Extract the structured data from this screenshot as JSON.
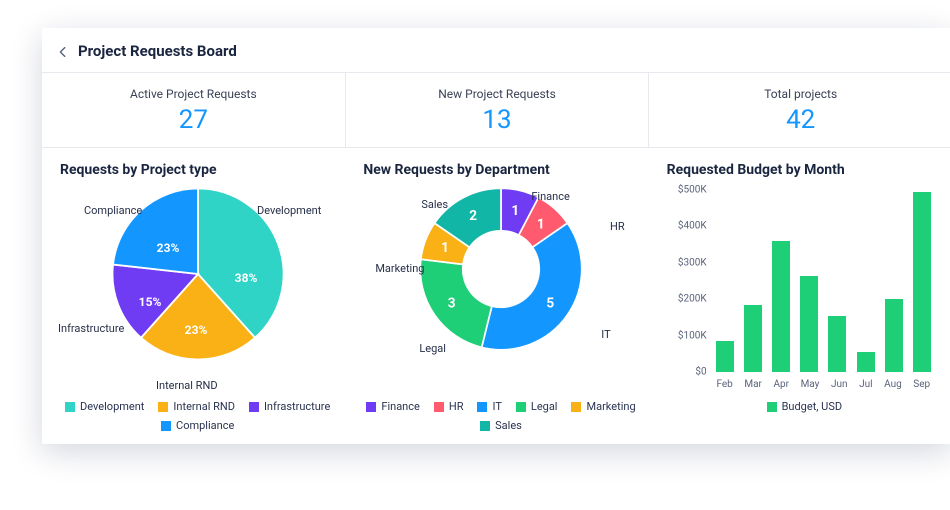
{
  "header": {
    "title": "Project Requests Board"
  },
  "kpis": [
    {
      "label": "Active Project Requests",
      "value": "27"
    },
    {
      "label": "New Project Requests",
      "value": "13"
    },
    {
      "label": "Total projects",
      "value": "42"
    }
  ],
  "panel1": {
    "title": "Requests by Project type"
  },
  "panel2": {
    "title": "New Requests by Department"
  },
  "panel3": {
    "title": "Requested Budget by Month"
  },
  "colors": {
    "development": "#2fd4c6",
    "internal_rnd": "#f9b116",
    "infrastructure": "#6f3cf4",
    "compliance": "#1496ff",
    "finance": "#6f3cf4",
    "hr": "#ff5a6e",
    "it": "#1496ff",
    "legal": "#1ecf78",
    "marketing": "#f9b116",
    "sales": "#12b6a6",
    "budget": "#1ecf78"
  },
  "chart_data": [
    {
      "type": "pie",
      "title": "Requests by Project type",
      "series": [
        {
          "name": "Development",
          "value": 38,
          "label": "38%",
          "color": "#2fd4c6"
        },
        {
          "name": "Internal RND",
          "value": 23,
          "label": "23%",
          "color": "#f9b116"
        },
        {
          "name": "Infrastructure",
          "value": 15,
          "label": "15%",
          "color": "#6f3cf4"
        },
        {
          "name": "Compliance",
          "value": 23,
          "label": "23%",
          "color": "#1496ff"
        }
      ],
      "legend": [
        "Development",
        "Internal RND",
        "Infrastructure",
        "Compliance"
      ]
    },
    {
      "type": "pie",
      "title": "New Requests by Department",
      "donut": true,
      "series": [
        {
          "name": "Finance",
          "value": 1,
          "label": "1",
          "color": "#6f3cf4"
        },
        {
          "name": "HR",
          "value": 1,
          "label": "1",
          "color": "#ff5a6e"
        },
        {
          "name": "IT",
          "value": 5,
          "label": "5",
          "color": "#1496ff"
        },
        {
          "name": "Legal",
          "value": 3,
          "label": "3",
          "color": "#1ecf78"
        },
        {
          "name": "Marketing",
          "value": 1,
          "label": "1",
          "color": "#f9b116"
        },
        {
          "name": "Sales",
          "value": 2,
          "label": "2",
          "color": "#12b6a6"
        }
      ],
      "legend": [
        "Finance",
        "HR",
        "IT",
        "Legal",
        "Marketing",
        "Sales"
      ]
    },
    {
      "type": "bar",
      "title": "Requested Budget by Month",
      "categories": [
        "Feb",
        "Mar",
        "Apr",
        "May",
        "Jun",
        "Jul",
        "Aug",
        "Sep"
      ],
      "values": [
        85,
        185,
        360,
        265,
        155,
        55,
        200,
        495
      ],
      "ylabel": "",
      "xlabel": "",
      "ylim": [
        0,
        500
      ],
      "y_ticks": [
        "$0",
        "$100K",
        "$200K",
        "$300K",
        "$400K",
        "$500K"
      ],
      "legend": [
        "Budget, USD"
      ],
      "series_color": "#1ecf78"
    }
  ]
}
